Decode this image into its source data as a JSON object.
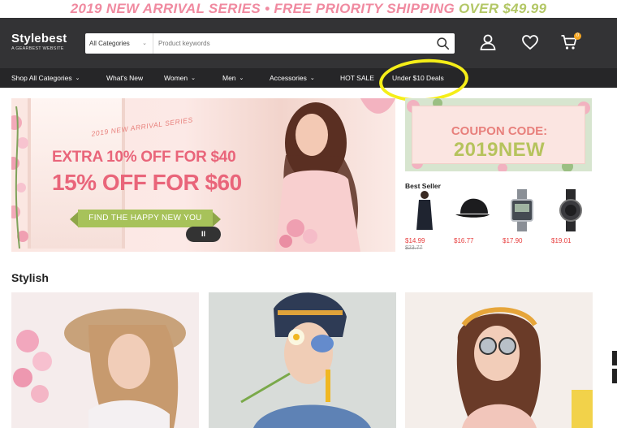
{
  "promo": {
    "part1": "2019 NEW ARRIVAL SERIES",
    "dot": "•",
    "part2": "FREE PRIORITY SHIPPING",
    "part3": "OVER $49.99"
  },
  "header": {
    "logo_name": "Stylebest",
    "logo_sub": "A GEARBEST WEBSITE",
    "category_select": "All Categories",
    "search_placeholder": "Product keywords",
    "cart_count": "0",
    "icons": [
      "search-icon",
      "account-icon",
      "wishlist-heart-icon",
      "cart-icon"
    ]
  },
  "nav": {
    "items": [
      {
        "label": "Shop All Categories",
        "caret": "⌄"
      },
      {
        "label": "What's New"
      },
      {
        "label": "Women",
        "caret": "⌄"
      },
      {
        "label": "Men",
        "caret": "⌄"
      },
      {
        "label": "Accessories",
        "caret": "⌄"
      },
      {
        "label": "HOT SALE"
      },
      {
        "label": "Under $10 Deals"
      }
    ]
  },
  "hero": {
    "series": "2019 NEW ARRIVAL SERIES",
    "line1": "EXTRA 10% OFF FOR $40",
    "line2": "15% OFF FOR $60",
    "cta": "FIND THE HAPPY NEW YOU",
    "pause": "II"
  },
  "coupon": {
    "label": "COUPON CODE:",
    "code": "2019NEW"
  },
  "best_seller": {
    "title": "Best Seller",
    "items": [
      {
        "price": "$14.99",
        "old_price": "$23.77"
      },
      {
        "price": "$16.77"
      },
      {
        "price": "$17.90"
      },
      {
        "price": "$19.01"
      }
    ]
  },
  "stylish": {
    "title": "Stylish"
  },
  "colors": {
    "header_bg": "#333335",
    "nav_bg": "#262628",
    "promo_pink": "#f08aa0",
    "promo_green": "#b3c766",
    "price_red": "#e73d3d",
    "highlight_yellow": "#f5ee18"
  }
}
